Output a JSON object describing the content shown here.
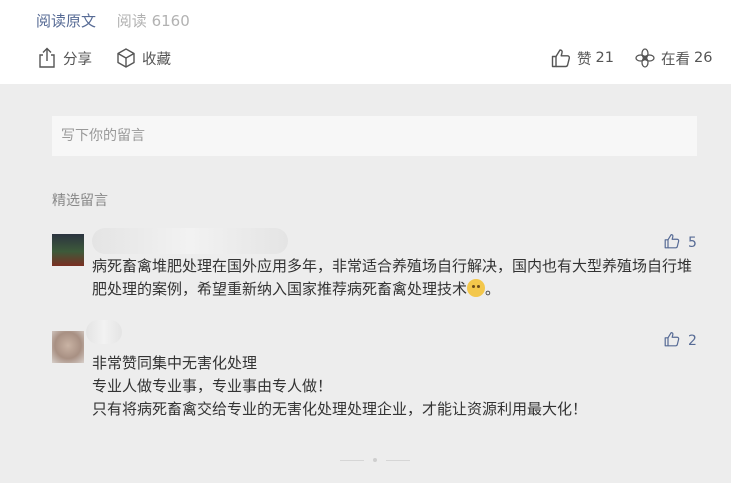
{
  "article": {
    "read_original": "阅读原文",
    "read_count": "阅读 6160"
  },
  "actions": {
    "share": "分享",
    "collect": "收藏",
    "like_label": "赞",
    "like_count": "21",
    "view_label": "在看",
    "view_count": "26"
  },
  "comment_input": {
    "placeholder": "写下你的留言"
  },
  "comments_section": {
    "title": "精选留言",
    "items": [
      {
        "likes": "5",
        "text": "病死畜禽堆肥处理在国外应用多年，非常适合养殖场自行解决，国内也有大型养殖场自行堆肥处理的案例，希望重新纳入国家推荐病死畜禽处理技术",
        "text_end": "。"
      },
      {
        "likes": "2",
        "lines": [
          "非常赞同集中无害化处理",
          "专业人做专业事，专业事由专人做！",
          "只有将病死畜禽交给专业的无害化处理处理企业，才能让资源利用最大化！"
        ]
      }
    ]
  },
  "colors": {
    "link_blue": "#576b95",
    "page_gray": "#ededed",
    "panel_white": "#ffffff"
  },
  "icons": [
    "share-icon",
    "cube-icon",
    "thumbs-up-icon",
    "flower-icon",
    "emoji-icon"
  ]
}
